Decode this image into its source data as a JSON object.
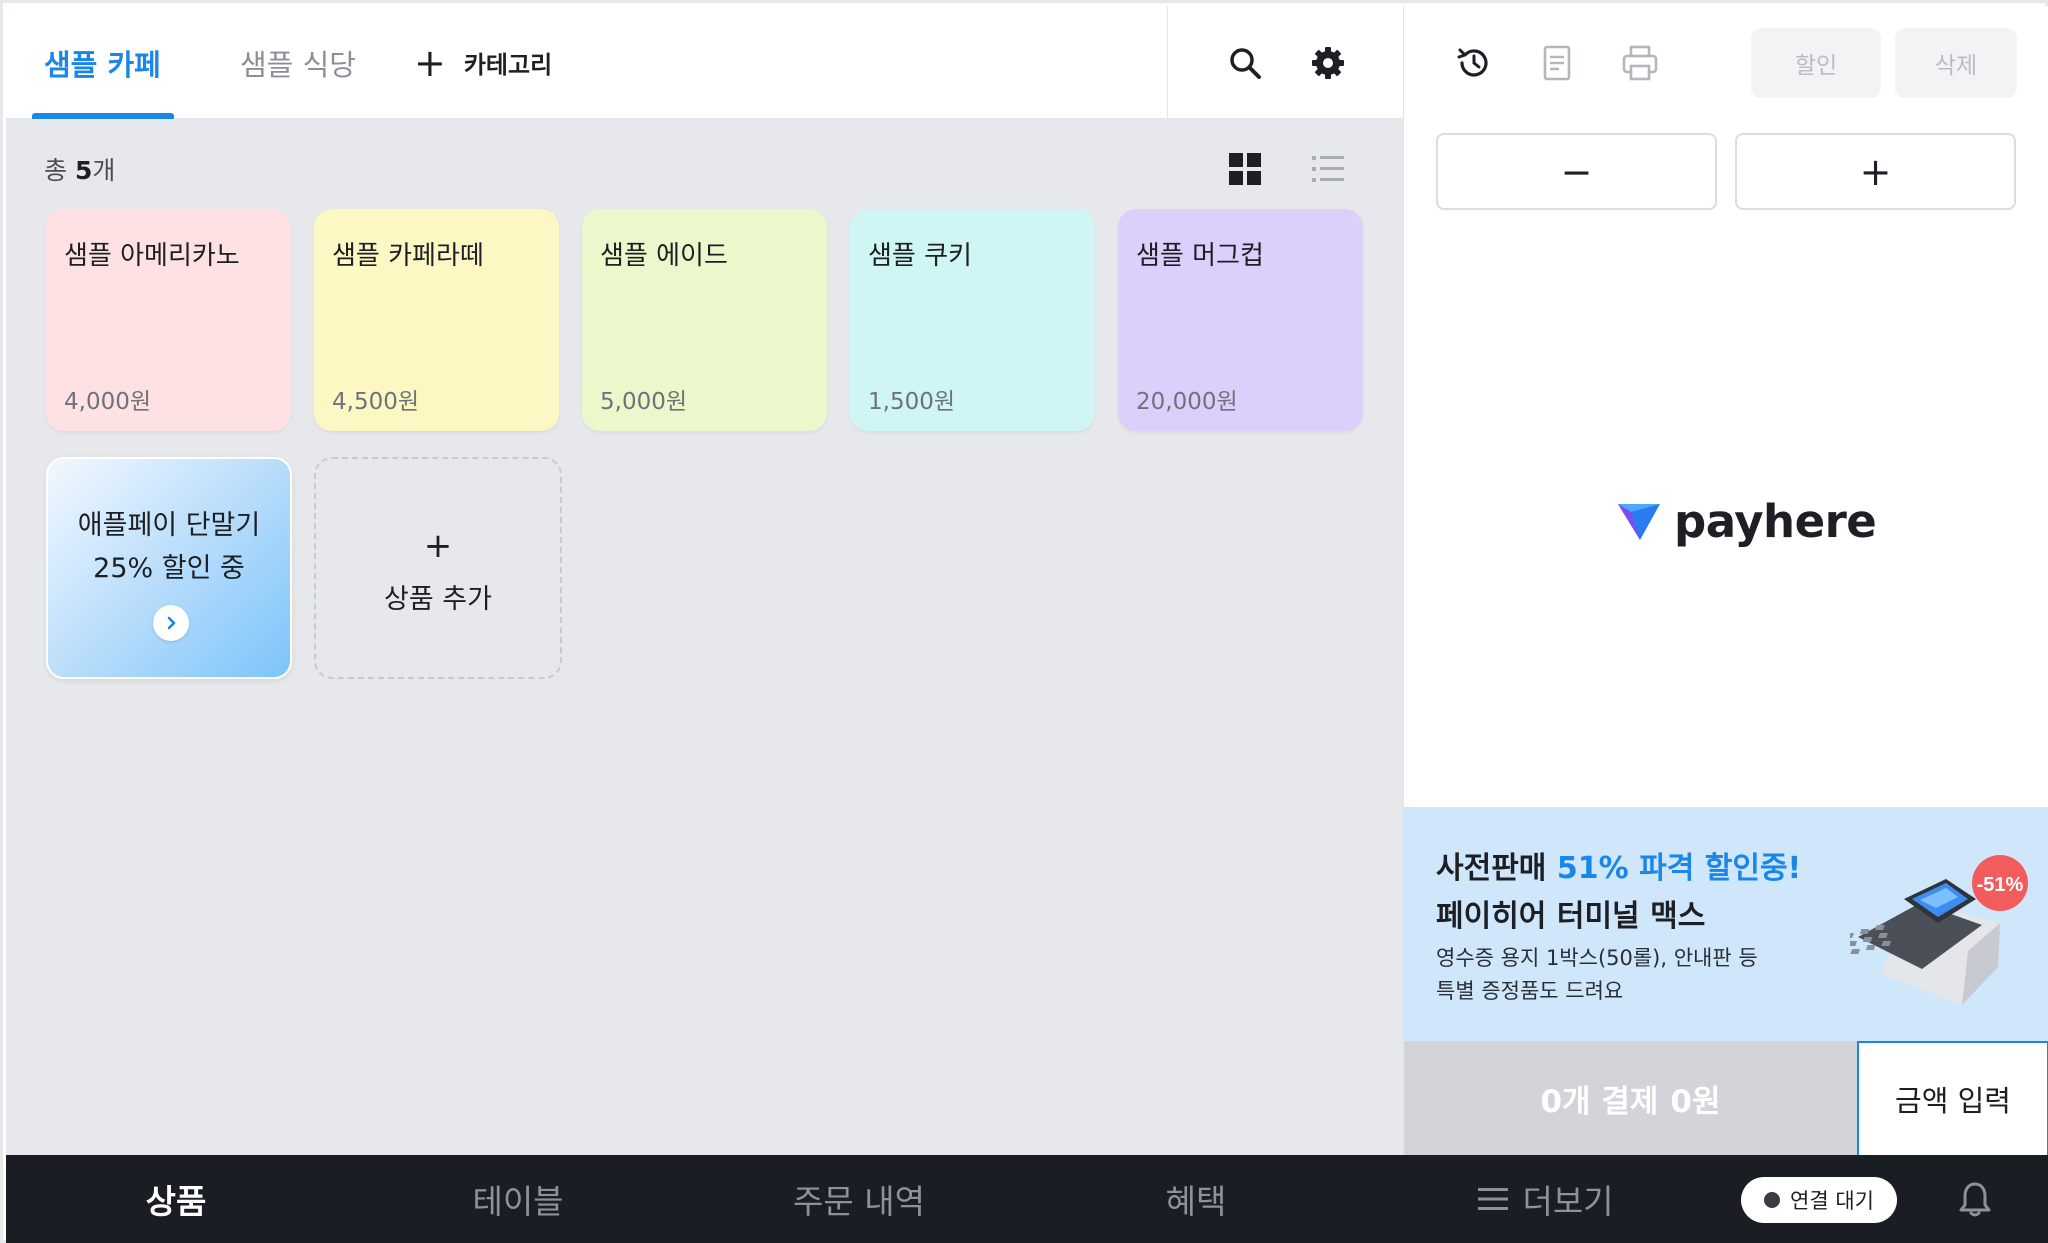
{
  "header": {
    "tabs": [
      {
        "label": "샘플 카페",
        "active": true
      },
      {
        "label": "샘플 식당",
        "active": false
      }
    ],
    "add_category_label": "카테고리",
    "icons": [
      "search-icon",
      "gear-icon"
    ]
  },
  "summary": {
    "prefix": "총 ",
    "count": "5",
    "suffix": "개"
  },
  "view_icons": [
    "grid-view-icon",
    "list-view-icon"
  ],
  "products": [
    {
      "name": "샘플 아메리카노",
      "price": "4,000원",
      "color": "#fee1e3"
    },
    {
      "name": "샘플 카페라떼",
      "price": "4,500원",
      "color": "#fdf7c3"
    },
    {
      "name": "샘플 에이드",
      "price": "5,000원",
      "color": "#ebf8cb"
    },
    {
      "name": "샘플 쿠키",
      "price": "1,500원",
      "color": "#cff5f4"
    },
    {
      "name": "샘플 머그컵",
      "price": "20,000원",
      "color": "#dccffb"
    }
  ],
  "promo_card": {
    "line1": "애플페이 단말기",
    "line2": "25% 할인 중"
  },
  "add_product": {
    "plus": "+",
    "label": "상품 추가"
  },
  "order_panel": {
    "icons": [
      "history-icon",
      "receipt-icon",
      "printer-icon"
    ],
    "discount_label": "할인",
    "delete_label": "삭제",
    "minus_label": "−",
    "plus_label": "+",
    "brand_name": "payhere"
  },
  "ad": {
    "headline_prefix": "사전판매 ",
    "headline_highlight": "51% 파격 할인중!",
    "headline2": "페이히어 터미널 맥스",
    "sub1": "영수증 용지 1박스(50롤), 안내판 등",
    "sub2": "특별 증정품도 드려요",
    "badge": "-51%"
  },
  "payment": {
    "count_label": "0개 결제",
    "amount": "0원",
    "amount_input_label": "금액 입력"
  },
  "bottom_nav": {
    "items": [
      {
        "label": "상품",
        "active": true
      },
      {
        "label": "테이블",
        "active": false
      },
      {
        "label": "주문 내역",
        "active": false
      },
      {
        "label": "혜택",
        "active": false
      },
      {
        "label": "더보기",
        "active": false
      }
    ],
    "status_label": "연결 대기"
  },
  "colors": {
    "accent": "#1a86e8",
    "nav_bg": "#1b1d24",
    "panel_bg": "#e6e8eb"
  }
}
